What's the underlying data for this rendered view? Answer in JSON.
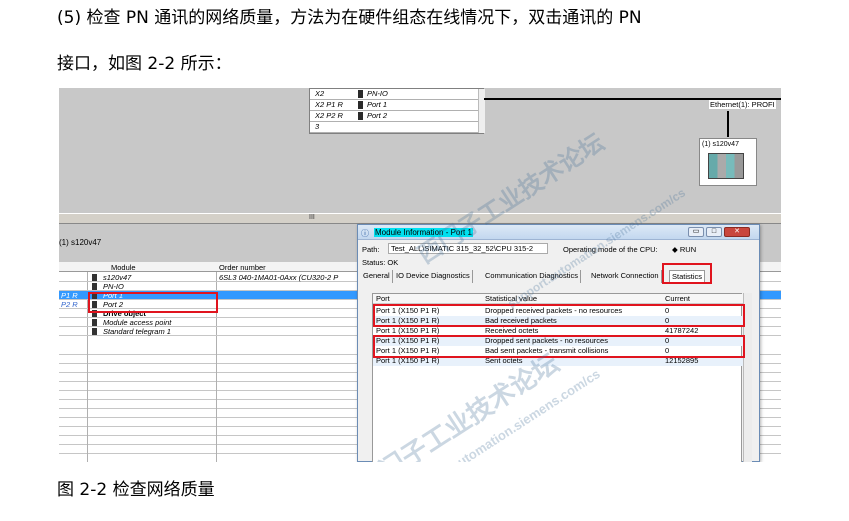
{
  "doc": {
    "paragraph_line1": "(5) 检查 PN 通讯的网络质量，方法为在硬件组态在线情况下，双击通讯的 PN",
    "paragraph_line2": "接口，如图 2-2 所示：",
    "caption": "图 2-2 检查网络质量"
  },
  "hw_top": {
    "rows": [
      {
        "slot": "X2",
        "module": "PN-IO"
      },
      {
        "slot": "X2 P1 R",
        "module": "Port 1"
      },
      {
        "slot": "X2 P2 R",
        "module": "Port 2"
      },
      {
        "slot": "3",
        "module": ""
      }
    ],
    "ethernet_label": "Ethernet(1): PROFI",
    "station_label": "(1) s120v47",
    "splitter_grip": "III"
  },
  "station_view": {
    "title": "(1)  s120v47",
    "col_module": "Module",
    "col_order": "Order number",
    "rows": [
      {
        "slot": "",
        "module": "s120v47",
        "order": "6SL3 040-1MA01-0Axx (CU320-2 P",
        "selected": false,
        "bold": false
      },
      {
        "slot": "",
        "module": "PN-IO",
        "order": "",
        "selected": false,
        "bold": false
      },
      {
        "slot": "P1 R",
        "module": "Port 1",
        "order": "",
        "selected": true,
        "bold": false
      },
      {
        "slot": "P2 R",
        "module": "Port 2",
        "order": "",
        "selected": false,
        "bold": false
      },
      {
        "slot": "",
        "module": "Drive object",
        "order": "",
        "selected": false,
        "bold": true
      },
      {
        "slot": "",
        "module": "Module access point",
        "order": "",
        "selected": false,
        "bold": false
      },
      {
        "slot": "",
        "module": "Standard telegram 1",
        "order": "",
        "selected": false,
        "bold": false
      }
    ]
  },
  "dialog": {
    "title": "Module Information - Port 1",
    "path_label": "Path:",
    "path_value": "Test_ALL\\SIMATIC 315_32_52\\CPU 315-2",
    "op_mode_label": "Operating mode of the  CPU:",
    "op_mode_value": "RUN",
    "status": "Status: OK",
    "tabs": [
      "General",
      "IO Device Diagnostics",
      "Communication Diagnostics",
      "Network Connection",
      "Statistics"
    ],
    "col_port": "Port",
    "col_stat": "Statistical value",
    "col_current": "Current",
    "rows": [
      {
        "port": "Port 1 (X150 P1 R)",
        "stat": "Dropped received packets - no resources",
        "current": "0"
      },
      {
        "port": "Port 1 (X150 P1 R)",
        "stat": "Bad received packets",
        "current": "0"
      },
      {
        "port": "Port 1 (X150 P1 R)",
        "stat": "Received octets",
        "current": "41787242"
      },
      {
        "port": "Port 1 (X150 P1 R)",
        "stat": "Dropped sent packets - no resources",
        "current": "0"
      },
      {
        "port": "Port 1 (X150 P1 R)",
        "stat": "Bad sent packets - transmit collisions",
        "current": "0"
      },
      {
        "port": "Port 1 (X150 P1 R)",
        "stat": "Sent octets",
        "current": "12152895"
      }
    ],
    "buttons": {
      "minimize": "▭",
      "maximize": "□",
      "close": "✕"
    }
  },
  "watermark": {
    "line1": "西门子工业技术论坛",
    "line2": "support.automation.siemens.com/cs"
  },
  "colors": {
    "highlight_red": "#e0141e",
    "selection_blue": "#3399ff",
    "title_cyan": "#00e0f0"
  }
}
